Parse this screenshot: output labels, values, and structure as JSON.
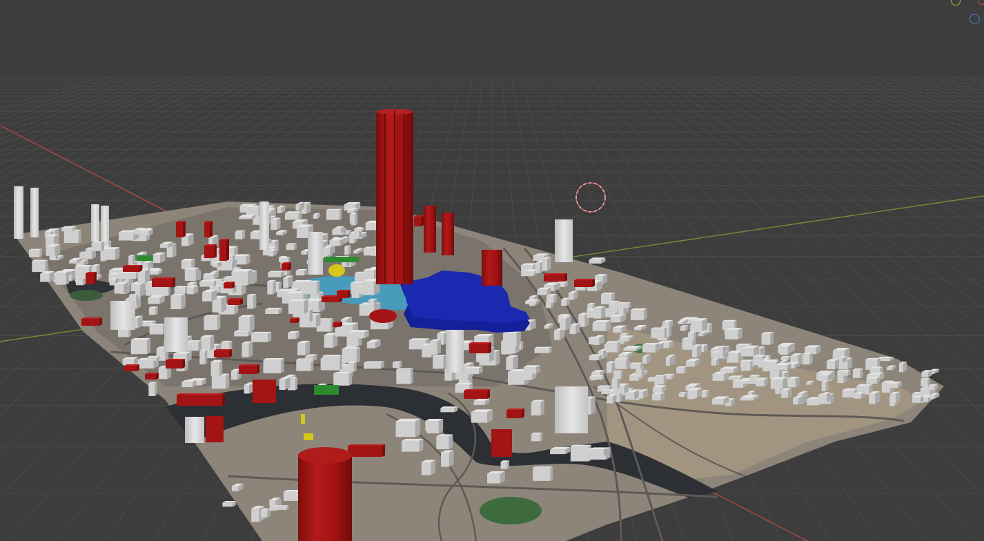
{
  "viewport": {
    "background": "#3d3d3d",
    "grid_line_color": "#4a4a4a",
    "axis_x_color": "#b04848",
    "axis_y_color": "#6f8f3a",
    "cursor_color": "#d85c5c"
  },
  "scene": {
    "ground_texture_color": "#8a8378",
    "water_color": "#2c2f33",
    "building_color": "#d4d4d4",
    "highlight_red": "#a31414",
    "highlight_blue": "#141f9a",
    "highlight_green": "#2e8a2e",
    "highlight_yellow": "#d6c61a",
    "pond_color": "#3fa2c8"
  },
  "gizmo": {
    "y_axis_color": "#9ac33a",
    "z_axis_color": "#4f7fd0",
    "x_axis_color": "#d94a4a"
  }
}
